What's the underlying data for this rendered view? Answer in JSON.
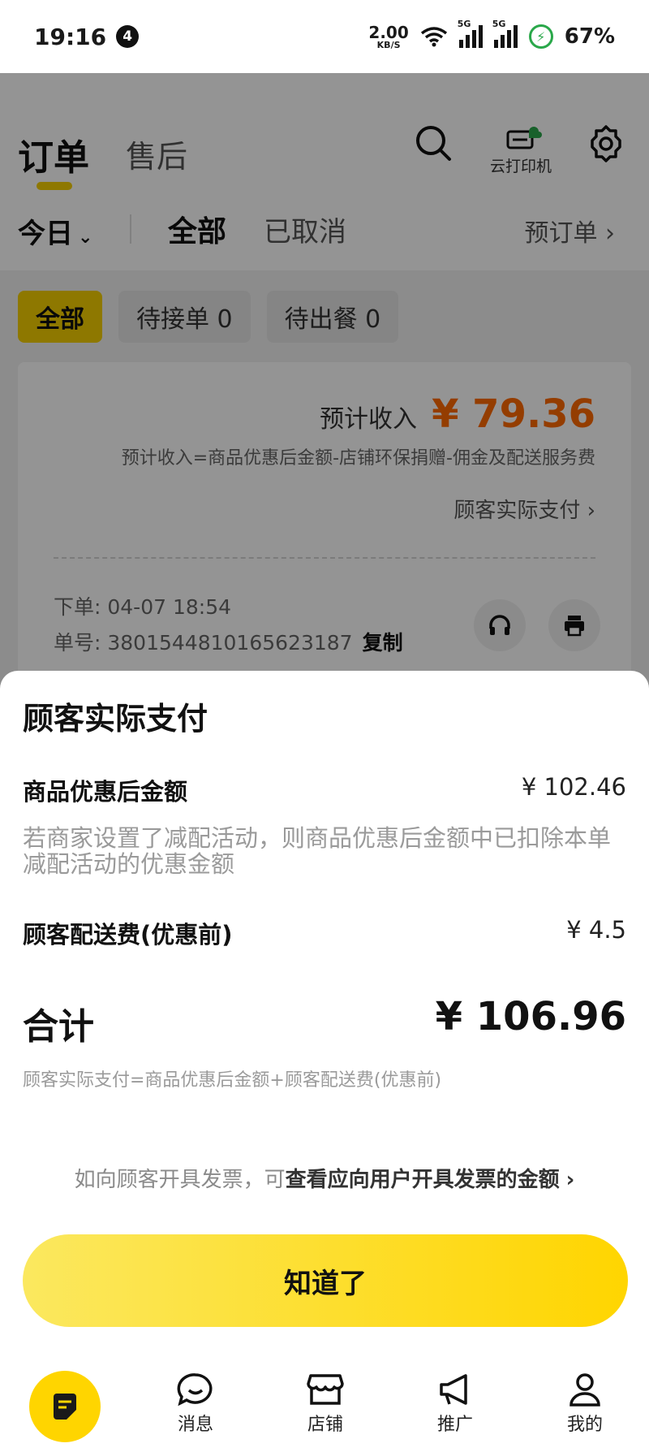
{
  "status_bar": {
    "time": "19:16",
    "notification_count": "4",
    "net_speed_value": "2.00",
    "net_speed_unit": "KB/S",
    "signal1_label": "5G",
    "signal2_label": "5G",
    "battery_icon": "⚡",
    "battery_percent": "67%"
  },
  "header": {
    "tab_orders": "订单",
    "tab_after_sale": "售后",
    "cloud_printer_label": "云打印机"
  },
  "filters": {
    "date": "今日",
    "all": "全部",
    "cancelled": "已取消",
    "preorder": "预订单 ›"
  },
  "chips": [
    {
      "label": "全部"
    },
    {
      "label": "待接单 0"
    },
    {
      "label": "待出餐 0"
    }
  ],
  "order_card": {
    "income_label": "预计收入",
    "income_value": "¥ 79.36",
    "income_formula": "预计收入=商品优惠后金额-店铺环保捐赠-佣金及配送服务费",
    "actual_pay_link": "顾客实际支付 ›",
    "order_time": "下单: 04-07 18:54",
    "order_no": "单号: 3801544810165623187",
    "copy_label": "复制"
  },
  "sheet": {
    "title": "顾客实际支付",
    "goods_label": "商品优惠后金额",
    "goods_value": "¥ 102.46",
    "goods_note": "若商家设置了减配活动，则商品优惠后金额中已扣除本单减配活动的优惠金额",
    "delivery_label": "顾客配送费(优惠前)",
    "delivery_value": "¥ 4.5",
    "total_label": "合计",
    "total_value": "¥ 106.96",
    "total_formula": "顾客实际支付=商品优惠后金额+顾客配送费(优惠前)",
    "invoice_prefix": "如向顾客开具发票，可",
    "invoice_link": "查看应向用户开具发票的金额",
    "invoice_chevron": "›",
    "ok_button": "知道了"
  },
  "bottom_nav": {
    "messages": "消息",
    "store": "店铺",
    "promote": "推广",
    "mine": "我的"
  },
  "colors": {
    "brand_yellow": "#ffd500",
    "income_orange": "#ff6a00",
    "overlay": "rgba(0,0,0,0.42)"
  }
}
